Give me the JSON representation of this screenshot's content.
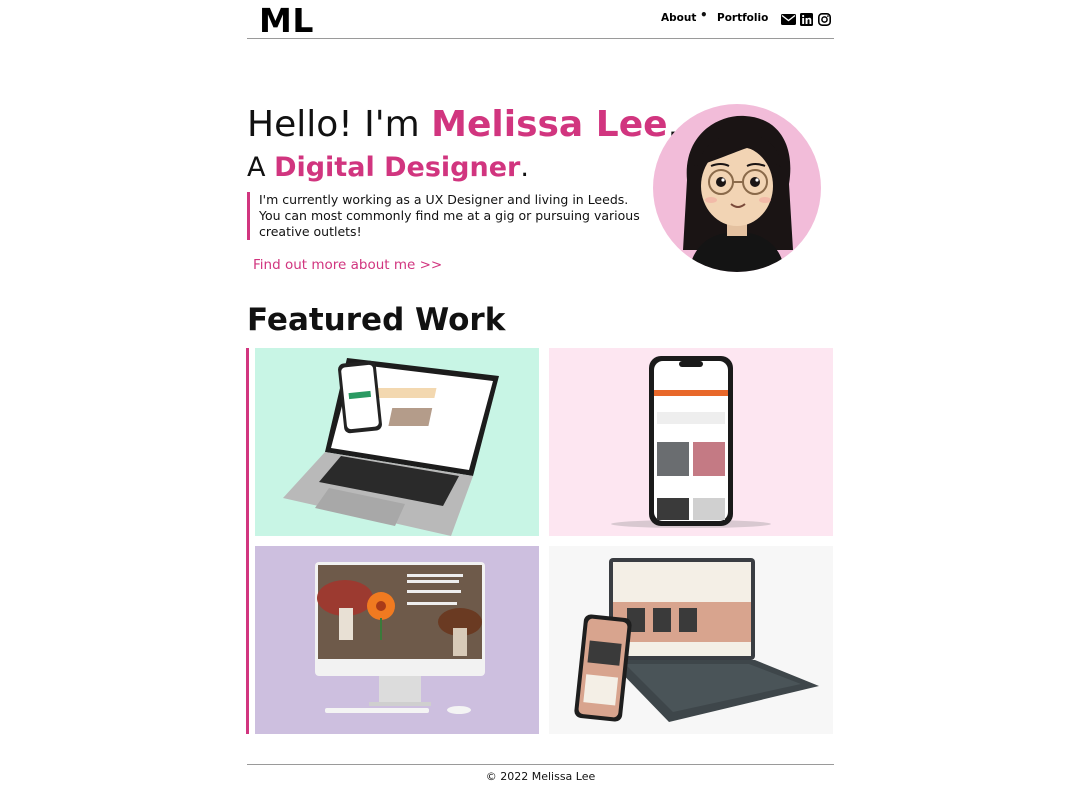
{
  "header": {
    "logo": "ML",
    "nav": [
      {
        "label": "About"
      },
      {
        "label": "Portfolio"
      }
    ],
    "separator": "•",
    "social_icons": [
      "email-icon",
      "linkedin-icon",
      "instagram-icon"
    ]
  },
  "hero": {
    "greeting": "Hello! I'm ",
    "name": "Melissa Lee",
    "period": ".",
    "role_prefix": "A ",
    "role": "Digital Designer",
    "role_period": ".",
    "intro_line1": "I'm currently working as a UX Designer and living in Leeds.",
    "intro_line2": "You can most commonly find me at a gig or pursuing various creative outlets!",
    "more_link": "Find out more about me >>"
  },
  "featured": {
    "title": "Featured Work"
  },
  "footer": {
    "copyright": "© 2022 Melissa Lee"
  },
  "colors": {
    "accent": "#d1357f",
    "avatar_bg": "#f2bcd9",
    "tile1_bg": "#c8f5e5",
    "tile2_bg": "#fde6f1",
    "tile3_bg": "#cdbfdf",
    "tile4_bg": "#f7f7f7"
  }
}
